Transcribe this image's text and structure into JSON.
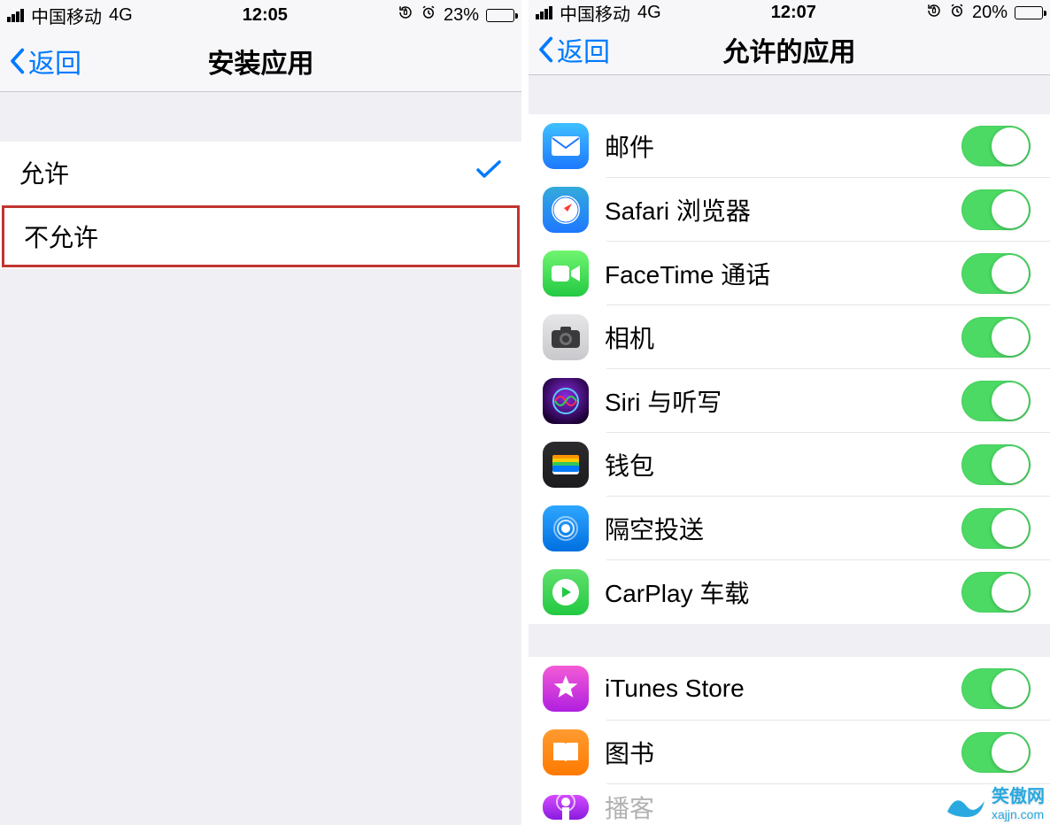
{
  "left": {
    "status": {
      "carrier": "中国移动",
      "network": "4G",
      "time": "12:05",
      "battery_pct": "23%",
      "battery_fill_pct": 23,
      "battery_low": false
    },
    "nav": {
      "back_label": "返回",
      "title": "安装应用"
    },
    "options": {
      "allow": "允许",
      "disallow": "不允许",
      "selected": "allow"
    }
  },
  "right": {
    "status": {
      "carrier": "中国移动",
      "network": "4G",
      "time": "12:07",
      "battery_pct": "20%",
      "battery_fill_pct": 20,
      "battery_low": true
    },
    "nav": {
      "back_label": "返回",
      "title": "允许的应用"
    },
    "apps_group1": [
      {
        "icon": "mail-icon",
        "label": "邮件",
        "on": true
      },
      {
        "icon": "safari-icon",
        "label": "Safari 浏览器",
        "on": true
      },
      {
        "icon": "facetime-icon",
        "label": "FaceTime 通话",
        "on": true
      },
      {
        "icon": "camera-icon",
        "label": "相机",
        "on": true
      },
      {
        "icon": "siri-icon",
        "label": "Siri 与听写",
        "on": true
      },
      {
        "icon": "wallet-icon",
        "label": "钱包",
        "on": true
      },
      {
        "icon": "airdrop-icon",
        "label": "隔空投送",
        "on": true
      },
      {
        "icon": "carplay-icon",
        "label": "CarPlay 车载",
        "on": true
      }
    ],
    "apps_group2": [
      {
        "icon": "itunes-icon",
        "label": "iTunes Store",
        "on": true
      },
      {
        "icon": "books-icon",
        "label": "图书",
        "on": true
      },
      {
        "icon": "podcast-icon",
        "label": "播客",
        "on": true
      }
    ]
  },
  "watermark": {
    "name": "笑傲网",
    "url": "xajjn.com"
  }
}
